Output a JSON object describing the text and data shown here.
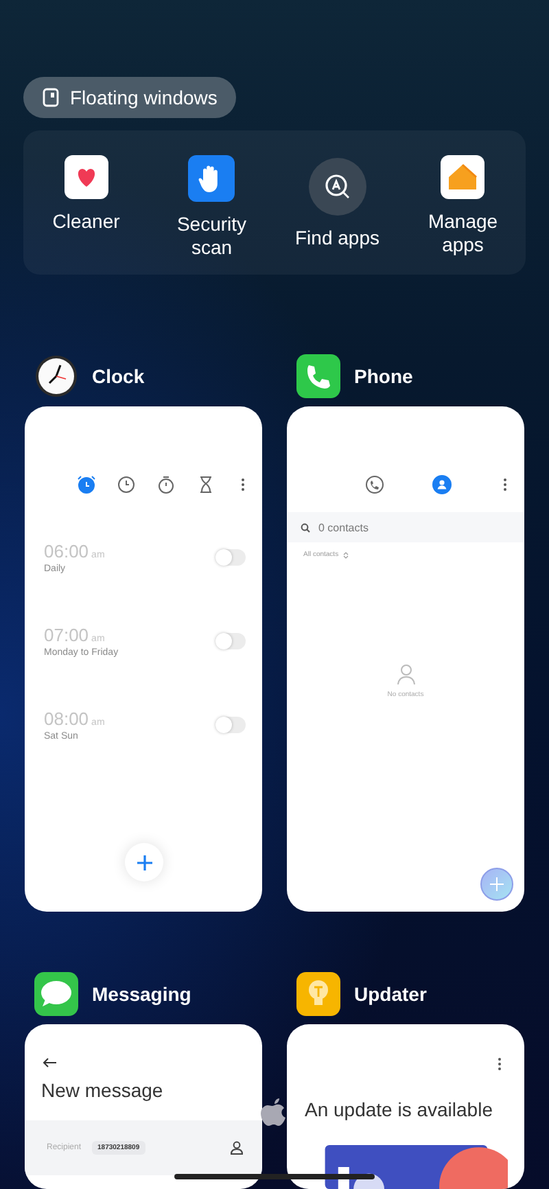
{
  "floating_windows": {
    "label": "Floating windows"
  },
  "shortcuts": [
    {
      "kind": "cleaner",
      "label": "Cleaner"
    },
    {
      "kind": "security",
      "label": "Security scan"
    },
    {
      "kind": "find",
      "label": "Find apps"
    },
    {
      "kind": "manage",
      "label": "Manage apps"
    }
  ],
  "clock": {
    "name": "Clock",
    "tabs": [
      {
        "kind": "alarm",
        "selected": true
      },
      {
        "kind": "clock",
        "selected": false
      },
      {
        "kind": "stopwatch",
        "selected": false
      },
      {
        "kind": "timer",
        "selected": false
      }
    ],
    "alarms": [
      {
        "time": "06:00",
        "period": "am",
        "repeat": "Daily",
        "on": false
      },
      {
        "time": "07:00",
        "period": "am",
        "repeat": "Monday to Friday",
        "on": false
      },
      {
        "time": "08:00",
        "period": "am",
        "repeat": "Sat Sun",
        "on": false
      }
    ]
  },
  "phone": {
    "name": "Phone",
    "tabs": [
      {
        "kind": "calls",
        "selected": false
      },
      {
        "kind": "contacts",
        "selected": true
      }
    ],
    "search": {
      "placeholder": "0 contacts"
    },
    "filter": "All contacts",
    "empty": "No contacts"
  },
  "messaging": {
    "name": "Messaging",
    "title": "New message",
    "recipient_label": "Recipient",
    "recipient": "18730218809"
  },
  "updater": {
    "name": "Updater",
    "title": "An update is available"
  }
}
